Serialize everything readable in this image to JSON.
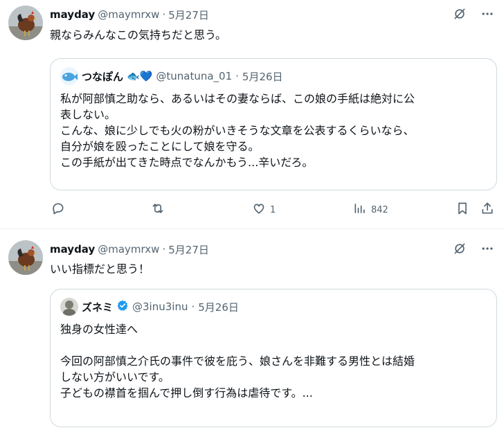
{
  "tweets": [
    {
      "name": "mayday",
      "handle": "@maymrxw",
      "sep": "·",
      "date": "5月27日",
      "text": "親ならみんなこの気持ちだと思う。",
      "quote": {
        "name": "つなぽん",
        "name_suffix": "🐟💙",
        "handle": "@tunatuna_01",
        "sep": "·",
        "date": "5月26日",
        "lines": [
          "私が阿部慎之助なら、あるいはその妻ならば、この娘の手紙は絶対に公",
          "表しない。",
          "こんな、娘に少しでも火の粉がいきそうな文章を公表するくらいなら、",
          "自分が娘を殴ったことにして娘を守る。",
          "この手紙が出てきた時点でなんかもう...辛いだろ。"
        ]
      },
      "actions": {
        "likes": "1",
        "views": "842"
      }
    },
    {
      "name": "mayday",
      "handle": "@maymrxw",
      "sep": "·",
      "date": "5月27日",
      "text": "いい指標だと思う！",
      "quote": {
        "name": "ズネミ",
        "handle": "@3inu3inu",
        "sep": "·",
        "date": "5月26日",
        "lines": [
          "独身の女性達へ",
          "",
          "今回の阿部慎之介氏の事件で彼を庇う、娘さんを非難する男性とは結婚",
          "しない方がいいです。",
          "子どもの襟首を掴んで押し倒す行為は虐待です。..."
        ]
      }
    }
  ],
  "colors": {
    "text": "#0f1419",
    "secondary": "#536471",
    "border": "#cfd9de",
    "verified": "#1d9bf0"
  }
}
